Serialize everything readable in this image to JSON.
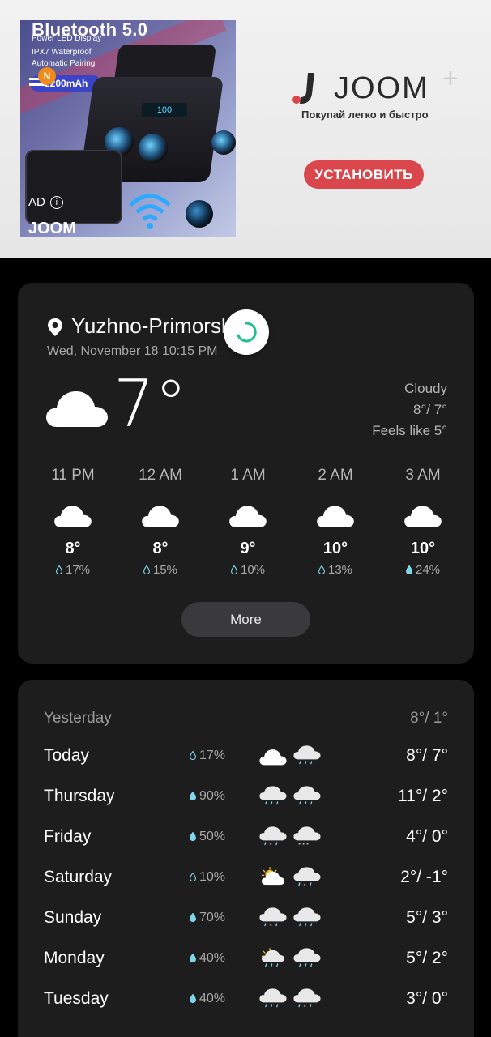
{
  "ad": {
    "product_title": "Bluetooth 5.0",
    "specs": [
      "Power LED Display",
      "IPX7 Waterproof",
      "Automatic Pairing"
    ],
    "battery": "2200mAh",
    "badge": "N",
    "display_text": "100",
    "ad_label": "AD",
    "info_icon": "info-icon",
    "brand_small": "JOOM",
    "brand": "JOOM",
    "tagline": "Покупай легко и быстро",
    "install_label": "УСТАНОВИТЬ",
    "colors": {
      "install": "#d9474d",
      "logo_red": "#d9474d"
    }
  },
  "current": {
    "location": "Yuzhno-Primorskiy",
    "datetime": "Wed, November 18 10:15 PM",
    "temp": "7°",
    "condition": "Cloudy",
    "high_low": "8°/ 7°",
    "feels_like": "Feels like 5°",
    "icon": "cloud-icon"
  },
  "hourly": [
    {
      "time": "11 PM",
      "temp": "8°",
      "rain": "17%",
      "icon": "cloud-icon",
      "drop_fill": 0.15
    },
    {
      "time": "12 AM",
      "temp": "8°",
      "rain": "15%",
      "icon": "cloud-icon",
      "drop_fill": 0.15
    },
    {
      "time": "1 AM",
      "temp": "9°",
      "rain": "10%",
      "icon": "cloud-icon",
      "drop_fill": 0.1
    },
    {
      "time": "2 AM",
      "temp": "10°",
      "rain": "13%",
      "icon": "cloud-icon",
      "drop_fill": 0.13
    },
    {
      "time": "3 AM",
      "temp": "10°",
      "rain": "24%",
      "icon": "cloud-icon",
      "drop_fill": 0.4
    }
  ],
  "more_label": "More",
  "daily": {
    "yesterday_label": "Yesterday",
    "yesterday_temp": "8°/ 1°",
    "days": [
      {
        "name": "Today",
        "rain": "17%",
        "temp": "8°/ 7°",
        "icon_day": "cloud-icon",
        "icon_night": "rain-icon",
        "drop_fill": 0.15
      },
      {
        "name": "Thursday",
        "rain": "90%",
        "temp": "11°/ 2°",
        "icon_day": "rain-icon",
        "icon_night": "rain-icon",
        "drop_fill": 1
      },
      {
        "name": "Friday",
        "rain": "50%",
        "temp": "4°/ 0°",
        "icon_day": "sleet-icon",
        "icon_night": "snow-icon",
        "drop_fill": 0.5
      },
      {
        "name": "Saturday",
        "rain": "10%",
        "temp": "2°/ -1°",
        "icon_day": "partly-cloudy-icon",
        "icon_night": "sleet-icon",
        "drop_fill": 0.1
      },
      {
        "name": "Sunday",
        "rain": "70%",
        "temp": "5°/ 3°",
        "icon_day": "sleet-icon",
        "icon_night": "rain-icon",
        "drop_fill": 0.7
      },
      {
        "name": "Monday",
        "rain": "40%",
        "temp": "5°/ 2°",
        "icon_day": "sun-rain-icon",
        "icon_night": "rain-icon",
        "drop_fill": 0.4
      },
      {
        "name": "Tuesday",
        "rain": "40%",
        "temp": "3°/ 0°",
        "icon_day": "rain-icon",
        "icon_night": "sleet-icon",
        "drop_fill": 0.4
      }
    ]
  },
  "colors": {
    "background": "#000000",
    "card": "#1d1d1e",
    "rain_accent": "#7fd6e8",
    "loading_accent": "#1fbf8f"
  }
}
